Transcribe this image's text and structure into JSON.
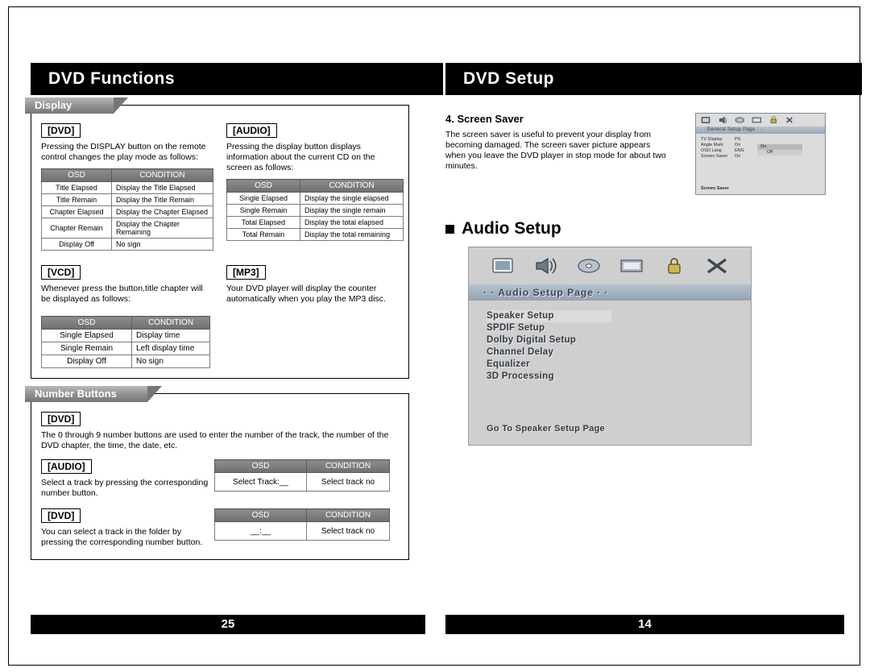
{
  "left": {
    "title": "DVD Functions",
    "page_number": "25",
    "display_section": {
      "tab": "Display",
      "dvd": {
        "tag": "[DVD]",
        "text": "Pressing the DISPLAY button on the remote control changes the play mode as follows:",
        "table": {
          "headers": [
            "OSD",
            "CONDITION"
          ],
          "rows": [
            [
              "Title Elapsed",
              "Display the Title Elapsed"
            ],
            [
              "Title Remain",
              "Display the Title Remain"
            ],
            [
              "Chapter Elapsed",
              "Display the Chapter Elapsed"
            ],
            [
              "Chapter Remain",
              "Display the Chapter Remaining"
            ],
            [
              "Display Off",
              "No sign"
            ]
          ]
        }
      },
      "audio": {
        "tag": "[AUDIO]",
        "text": "Pressing the display button displays information about the current CD on the screen as follows:",
        "table": {
          "headers": [
            "OSD",
            "CONDITION"
          ],
          "rows": [
            [
              "Single Elapsed",
              "Display the single elapsed"
            ],
            [
              "Single Remain",
              "Display the single remain"
            ],
            [
              "Total Elapsed",
              "Display the total elapsed"
            ],
            [
              "Total Remain",
              "Display the total remaining"
            ]
          ]
        }
      },
      "vcd": {
        "tag": "[VCD]",
        "text": "Whenever press the button,title chapter will be displayed as follows:",
        "table": {
          "headers": [
            "OSD",
            "CONDITION"
          ],
          "rows": [
            [
              "Single Elapsed",
              "Display time"
            ],
            [
              "Single Remain",
              "Left display time"
            ],
            [
              "Display Off",
              "No sign"
            ]
          ]
        }
      },
      "mp3": {
        "tag": "[MP3]",
        "text": "Your DVD player will display the counter automatically when you play the MP3 disc."
      }
    },
    "number_section": {
      "tab": "Number Buttons",
      "dvd1": {
        "tag": "[DVD]",
        "text": "The 0 through 9 number buttons are used to enter the number of the track, the number of the DVD chapter, the time, the date, etc."
      },
      "audio": {
        "tag": "[AUDIO]",
        "text": "Select a track by pressing the corresponding number button.",
        "table": {
          "headers": [
            "OSD",
            "CONDITION"
          ],
          "rows": [
            [
              "Select Track:__",
              "Select track no"
            ]
          ]
        }
      },
      "dvd2": {
        "tag": "[DVD]",
        "text": "You can select a track in the folder by pressing the corresponding number button.",
        "table": {
          "headers": [
            "OSD",
            "CONDITION"
          ],
          "rows": [
            [
              "__:__",
              "Select track no"
            ]
          ]
        }
      }
    }
  },
  "right": {
    "title": "DVD Setup",
    "page_number": "14",
    "screen_saver": {
      "heading": "4. Screen Saver",
      "text": "The screen saver is useful to prevent your display from becoming damaged. The screen saver picture appears when you leave the DVD player in stop mode for about two minutes.",
      "mini": {
        "title": "· · General Setup Page · ·",
        "rows": [
          {
            "label": "TV Display",
            "value": "PS"
          },
          {
            "label": "Angle Mark",
            "value": "On"
          },
          {
            "label": "OSD Lang",
            "value": "ENG"
          },
          {
            "label": "Screen Saver",
            "value": "On"
          }
        ],
        "options": [
          "On",
          "Off"
        ],
        "footer": "Screen Saver"
      }
    },
    "audio_setup": {
      "heading": "Audio Setup",
      "screen_title": "· · Audio Setup Page · ·",
      "menu": [
        "Speaker Setup",
        "SPDIF Setup",
        "Dolby Digital Setup",
        "Channel Delay",
        "Equalizer",
        "3D Processing"
      ],
      "footer": "Go To Speaker Setup Page"
    }
  },
  "icons": {
    "bar": [
      "tv-icon",
      "speaker-icon",
      "disc-icon",
      "video-icon",
      "lock-icon",
      "tools-icon"
    ]
  }
}
